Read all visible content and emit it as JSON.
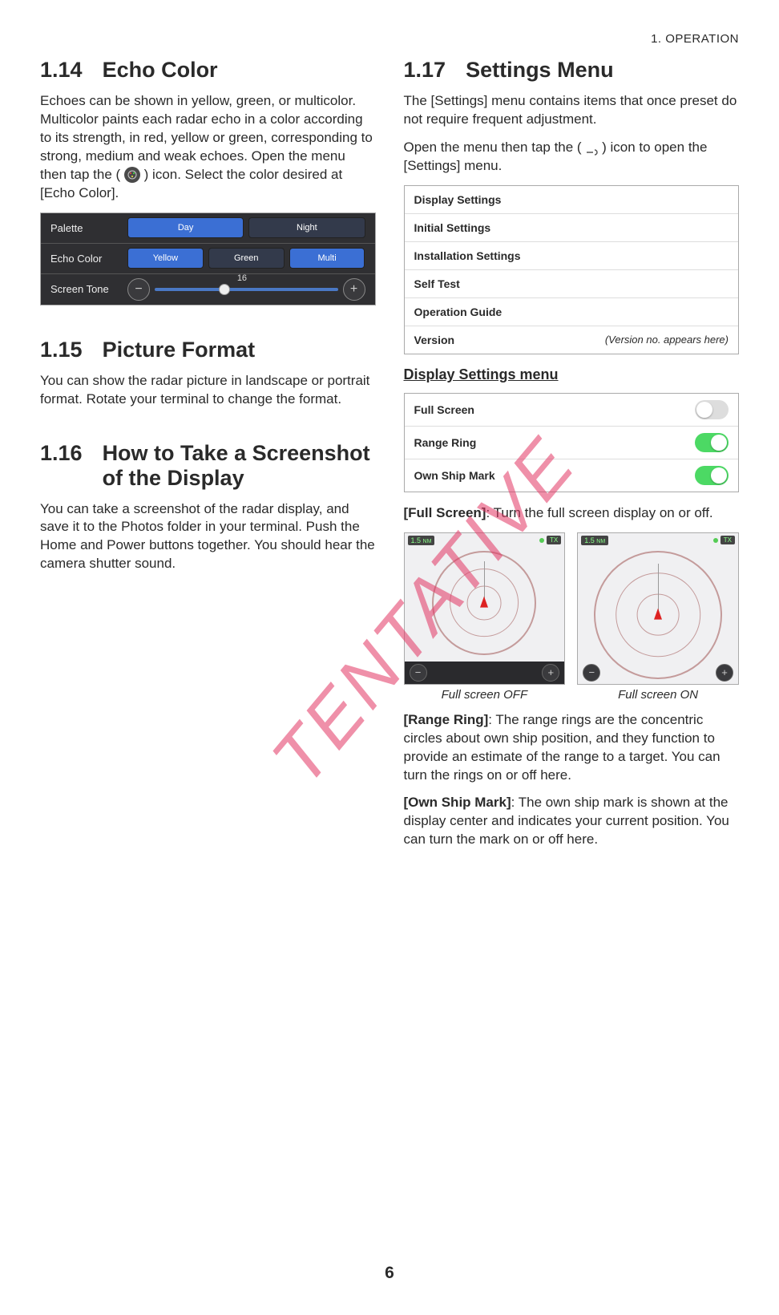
{
  "chapter": "1.  OPERATION",
  "watermark": "TENTATIVE",
  "page_number": "6",
  "left": {
    "s114": {
      "num": "1.14",
      "title": "Echo Color",
      "p1": "Echoes can be shown in yellow, green, or multicolor. Multicolor paints each radar echo in a color according to its strength, in red, yellow or green, corresponding to strong, medium and weak echoes. Open the menu then tap the (",
      "p1b": ") icon. Select the color desired at [Echo Color].",
      "palette": {
        "row1": "Palette",
        "row2": "Echo Color",
        "row3": "Screen Tone",
        "day": "Day",
        "night": "Night",
        "yellow": "Yellow",
        "green": "Green",
        "multi": "Multi",
        "tone_value": "16"
      }
    },
    "s115": {
      "num": "1.15",
      "title": "Picture Format",
      "p1": "You can show the radar picture in landscape or portrait format. Rotate your terminal to change the format."
    },
    "s116": {
      "num": "1.16",
      "title": "How to Take a Screenshot of the Display",
      "p1": "You can take a screenshot of the radar display, and save it to the Photos folder in your terminal. Push the Home and Power buttons together. You should hear the camera shutter sound."
    }
  },
  "right": {
    "s117": {
      "num": "1.17",
      "title": "Settings Menu",
      "p1": "The [Settings] menu contains items that once preset do not require frequent adjustment.",
      "p2a": "Open the menu then tap the (",
      "p2b": ") icon to open the [Settings] menu.",
      "menu": {
        "i1": "Display Settings",
        "i2": "Initial Settings",
        "i3": "Installation Settings",
        "i4": "Self Test",
        "i5": "Operation Guide",
        "i6": "Version",
        "i6_note": "(Version no. appears here)"
      },
      "subheading": "Display Settings menu",
      "toggles": {
        "t1": "Full Screen",
        "t2": "Range Ring",
        "t3": "Own Ship Mark"
      },
      "full_screen_desc_label": "[Full Screen]",
      "full_screen_desc": ": Turn the full screen display on or off.",
      "fig": {
        "range": "1.5",
        "unit": "NM",
        "tx": "TX",
        "cap_off": "Full screen OFF",
        "cap_on": "Full screen ON"
      },
      "range_ring_label": "[Range Ring]",
      "range_ring_desc": ": The range rings are the concentric circles about own ship position, and they function to provide an estimate of the range to a target. You can turn the rings on or off here.",
      "own_ship_label": "[Own Ship Mark]",
      "own_ship_desc": ": The own ship mark is shown at the display center and indicates your current position. You can turn the mark on or off here."
    }
  }
}
